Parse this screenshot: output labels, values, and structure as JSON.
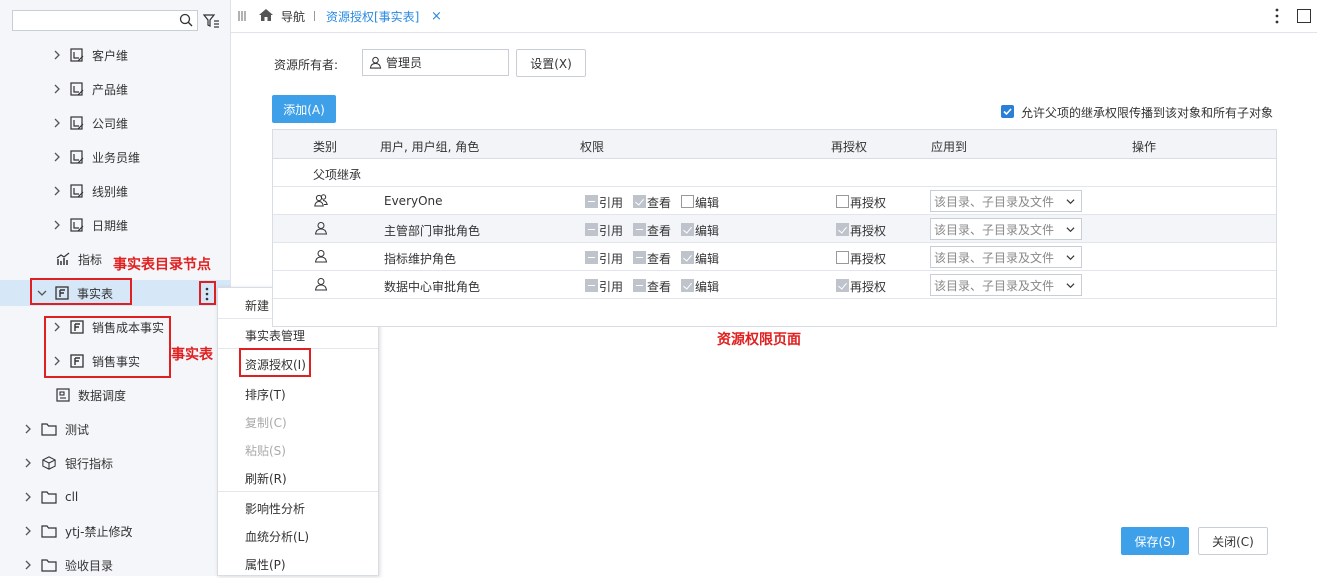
{
  "sidebar": {
    "search_placeholder": "",
    "tree": [
      {
        "label": "客户维",
        "icon": "dimension-icon"
      },
      {
        "label": "产品维",
        "icon": "dimension-icon"
      },
      {
        "label": "公司维",
        "icon": "dimension-icon"
      },
      {
        "label": "业务员维",
        "icon": "dimension-icon"
      },
      {
        "label": "线别维",
        "icon": "dimension-icon"
      },
      {
        "label": "日期维",
        "icon": "dimension-icon"
      },
      {
        "label": "指标",
        "icon": "metric-icon"
      },
      {
        "label": "事实表",
        "icon": "fact-table-icon"
      },
      {
        "label": "销售成本事实",
        "icon": "fact-table-icon"
      },
      {
        "label": "销售事实",
        "icon": "fact-table-icon"
      },
      {
        "label": "数据调度",
        "icon": "schedule-icon"
      },
      {
        "label": "测试",
        "icon": "folder-icon"
      },
      {
        "label": "银行指标",
        "icon": "cube-icon"
      },
      {
        "label": "cll",
        "icon": "folder-icon"
      },
      {
        "label": "ytj-禁止修改",
        "icon": "folder-icon"
      },
      {
        "label": "验收目录",
        "icon": "folder-icon"
      }
    ]
  },
  "annotations": {
    "fact_dir_node": "事实表目录节点",
    "fact_table": "事实表",
    "page": "资源权限页面"
  },
  "context_menu": {
    "items": [
      "新建",
      "事实表管理",
      "资源授权(I)",
      "排序(T)",
      "复制(C)",
      "粘贴(S)",
      "刷新(R)",
      "影响性分析",
      "血统分析(L)",
      "属性(P)"
    ]
  },
  "topbar": {
    "nav": "导航",
    "tab": "资源授权[事实表]",
    "tab_close": "×"
  },
  "form": {
    "owner_label": "资源所有者:",
    "owner_value": "管理员",
    "settings_button": "设置(X)",
    "add_button": "添加(A)",
    "inherit_label": "允许父项的继承权限传播到该对象和所有子对象"
  },
  "table": {
    "headers": {
      "type": "类别",
      "user": "用户, 用户组, 角色",
      "perm": "权限",
      "regrant": "再授权",
      "apply": "应用到",
      "action": "操作"
    },
    "inherit_row": "父项继承",
    "perm_labels": {
      "ref": "引用",
      "view": "查看",
      "edit": "编辑",
      "regrant": "再授权"
    },
    "rows": [
      {
        "user": "EveryOne",
        "apply": "该目录、子目录及文件"
      },
      {
        "user": "主管部门审批角色",
        "apply": "该目录、子目录及文件"
      },
      {
        "user": "指标维护角色",
        "apply": "该目录、子目录及文件"
      },
      {
        "user": "数据中心审批角色",
        "apply": "该目录、子目录及文件"
      }
    ]
  },
  "footer": {
    "save_button": "保存(S)",
    "close_button": "关闭(C)"
  }
}
